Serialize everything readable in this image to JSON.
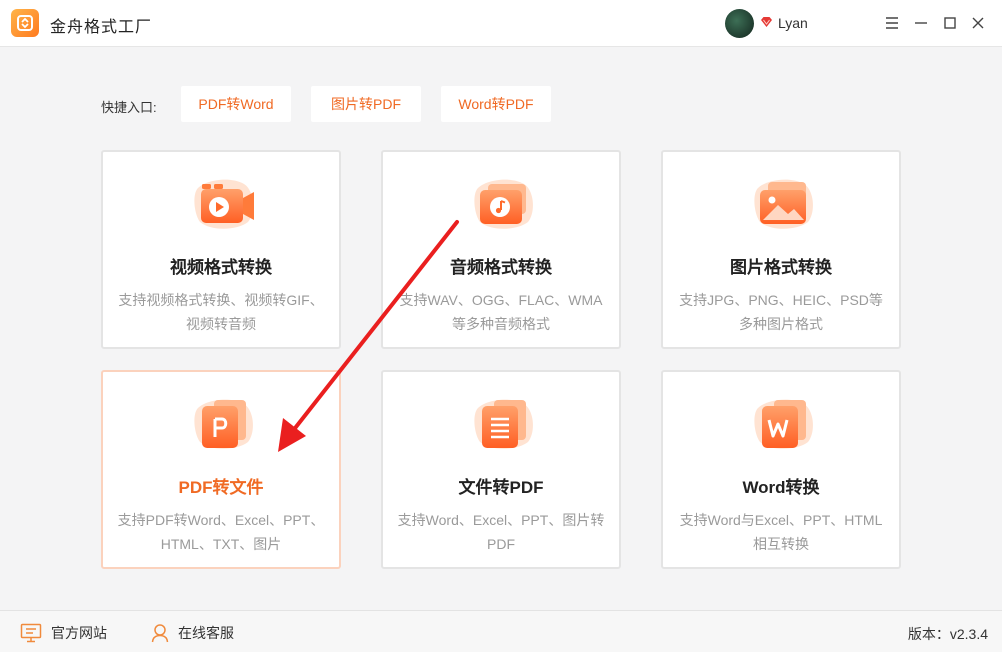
{
  "app": {
    "title": "金舟格式工厂"
  },
  "user": {
    "name": "Lyan"
  },
  "quick": {
    "label": "快捷入口:",
    "items": [
      "PDF转Word",
      "图片转PDF",
      "Word转PDF"
    ]
  },
  "cards": [
    {
      "title": "视频格式转换",
      "desc": "支持视频格式转换、视频转GIF、视频转音频",
      "icon": "video-icon"
    },
    {
      "title": "音频格式转换",
      "desc": "支持WAV、OGG、FLAC、WMA等多种音频格式",
      "icon": "audio-icon"
    },
    {
      "title": "图片格式转换",
      "desc": "支持JPG、PNG、HEIC、PSD等多种图片格式",
      "icon": "image-icon"
    },
    {
      "title": "PDF转文件",
      "desc": "支持PDF转Word、Excel、PPT、HTML、TXT、图片",
      "icon": "pdf-p-icon"
    },
    {
      "title": "文件转PDF",
      "desc": "支持Word、Excel、PPT、图片转PDF",
      "icon": "document-icon"
    },
    {
      "title": "Word转换",
      "desc": "支持Word与Excel、PPT、HTML相互转换",
      "icon": "word-w-icon"
    }
  ],
  "footer": {
    "site": "官方网站",
    "service": "在线客服",
    "version": "版本：v2.3.4"
  },
  "colors": {
    "accent": "#f06a24",
    "accent_light": "#ffb07a"
  }
}
